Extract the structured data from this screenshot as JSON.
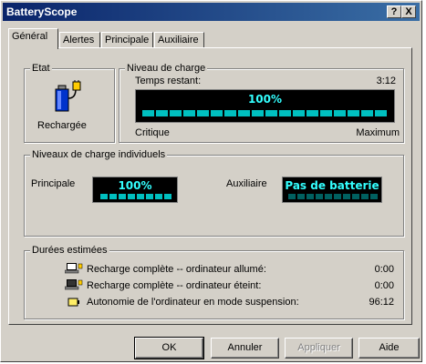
{
  "window": {
    "title": "BatteryScope",
    "help_btn": "?",
    "close_btn": "X"
  },
  "tabs": [
    {
      "label": "Général",
      "active": true
    },
    {
      "label": "Alertes",
      "active": false
    },
    {
      "label": "Principale",
      "active": false
    },
    {
      "label": "Auxiliaire",
      "active": false
    }
  ],
  "etat": {
    "title": "Etat",
    "status": "Rechargée"
  },
  "niveau": {
    "title": "Niveau de charge",
    "remaining_label": "Temps restant:",
    "remaining_value": "3:12",
    "percent": "100%",
    "fill_fraction": 1.0,
    "min_label": "Critique",
    "max_label": "Maximum"
  },
  "individuels": {
    "title": "Niveaux de charge individuels",
    "main_label": "Principale",
    "main_value": "100%",
    "main_fill_fraction": 1.0,
    "aux_label": "Auxiliaire",
    "aux_value": "Pas de batterie",
    "aux_fill_fraction": 0.0
  },
  "durees": {
    "title": "Durées estimées",
    "rows": [
      {
        "icon": "laptop-plug-on-icon",
        "label": "Recharge complète -- ordinateur allumé:",
        "value": "0:00"
      },
      {
        "icon": "laptop-plug-off-icon",
        "label": "Recharge complète -- ordinateur éteint:",
        "value": "0:00"
      },
      {
        "icon": "battery-icon",
        "label": "Autonomie de l'ordinateur en mode suspension:",
        "value": "96:12"
      }
    ]
  },
  "buttons": {
    "ok": "OK",
    "cancel": "Annuler",
    "apply": "Appliquer",
    "help": "Aide"
  },
  "colors": {
    "lcd_bg": "#000000",
    "lcd_text": "#33ffff",
    "lcd_segment": "#00c0c0",
    "lcd_segment_off": "#006060",
    "title_gradient_start": "#0a246a"
  }
}
